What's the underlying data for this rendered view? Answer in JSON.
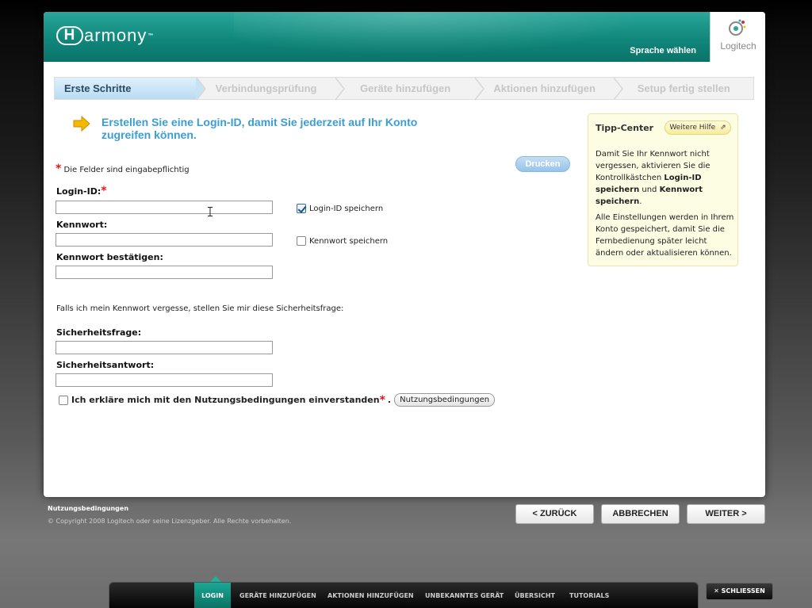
{
  "header": {
    "logo_text": "armony",
    "logo_mark": "H",
    "language_link": "Sprache wählen",
    "brand": "Logitech"
  },
  "steps": [
    {
      "label": "Erste Schritte",
      "active": true
    },
    {
      "label": "Verbindungsprüfung",
      "active": false
    },
    {
      "label": "Geräte hinzufügen",
      "active": false
    },
    {
      "label": "Aktionen hinzufügen",
      "active": false
    },
    {
      "label": "Setup fertig stellen",
      "active": false
    }
  ],
  "form": {
    "intro": "Erstellen Sie eine Login-ID, damit Sie jederzeit auf Ihr Konto zugreifen können.",
    "required_note": "Die Felder sind eingabepflichtig",
    "print_label": "Drucken",
    "login_id_label": "Login-ID:",
    "login_id_value": "",
    "remember_login_label": "Login-ID speichern",
    "remember_login_checked": true,
    "password_label": "Kennwort:",
    "password_value": "",
    "remember_password_label": "Kennwort speichern",
    "remember_password_checked": false,
    "confirm_password_label": "Kennwort bestätigen:",
    "confirm_password_value": "",
    "security_note": "Falls ich mein Kennwort vergesse, stellen Sie mir diese Sicherheitsfrage:",
    "security_question_label": "Sicherheitsfrage:",
    "security_question_value": "",
    "security_answer_label": "Sicherheitsantwort:",
    "security_answer_value": "",
    "terms_agree_label": "Ich erkläre mich mit den Nutzungsbedingungen einverstanden",
    "terms_agree_checked": false,
    "terms_button": "Nutzungsbedingungen"
  },
  "tip_center": {
    "title": "Tipp-Center",
    "help_button": "Weitere Hilfe",
    "p1_pre": "Damit Sie Ihr Kennwort nicht vergessen, aktivieren Sie die Kontrollkästchen ",
    "p1_bold1": "Login-ID speichern",
    "p1_mid": " und ",
    "p1_bold2": "Kennwort speichern",
    "p1_post": ".",
    "p2": "Alle Einstellungen werden in Ihrem Konto gespeichert, damit Sie die Fernbedienung später leicht ändern oder aktualisieren können."
  },
  "footer": {
    "terms_link": "Nutzungsbedingungen",
    "copyright": "© Copyright 2008 Logitech oder seine Lizenzgeber. Alle Rechte vorbehalten.",
    "back": "< ZURÜCK",
    "cancel": "ABBRECHEN",
    "next": "WEITER >"
  },
  "bottom_nav": {
    "items": [
      "LOGIN",
      "GERÄTE HINZUFÜGEN",
      "AKTIONEN HINZUFÜGEN",
      "UNBEKANNTES GERÄT",
      "ÜBERSICHT",
      "TUTORIALS"
    ],
    "close": "SCHLIESSEN"
  },
  "colors": {
    "header_teal": "#10877b",
    "intro_blue": "#3a9ed3",
    "required_red": "#e0161b",
    "tip_background": "#fdfde3"
  }
}
